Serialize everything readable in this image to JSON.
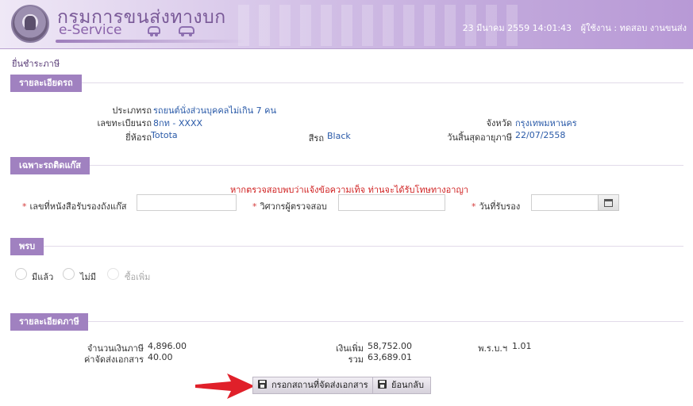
{
  "header": {
    "brand_th": "กรมการขนส่งทางบก",
    "brand_en": "e-Service",
    "datetime": "23 มีนาคม 2559 14:01:43",
    "user_label": "ผู้ใช้งาน : ทดสอบ  งานขนส่ง"
  },
  "breadcrumb": "ยื่นชำระภาษี",
  "vehicle": {
    "title": "รายละเอียดรถ",
    "type_label": "ประเภทรถ",
    "type_value": "รถยนต์นั่งส่วนบุคคลไม่เกิน 7 คน",
    "plate_label": "เลขทะเบียนรถ",
    "plate_value": "8กท - XXXX",
    "province_label": "จังหวัด",
    "province_value": "กรุงเทพมหานคร",
    "brand_label": "ยี่ห้อรถ",
    "brand_value": "Totota",
    "color_label": "สีรถ",
    "color_value": "Black",
    "expiry_label": "วันสิ้นสุดอายุภาษี",
    "expiry_value": "22/07/2558"
  },
  "gas": {
    "title": "เฉพาะรถติดแก๊ส",
    "warning": "หากตรวจสอบพบว่าแจ้งข้อความเท็จ ท่านจะได้รับโทษทางอาญา",
    "cert_label": "เลขที่หนังสือรับรองถังแก๊ส",
    "cert_value": "",
    "engineer_label": "วิศวกรผู้ตรวจสอบ",
    "engineer_value": "",
    "date_label": "วันที่รับรอง",
    "date_value": ""
  },
  "insurance": {
    "title": "พรบ",
    "options": [
      "มีแล้ว",
      "ไม่มี",
      "ซื้อเพิ่ม"
    ]
  },
  "tax": {
    "title": "รายละเอียดภาษี",
    "amount_label": "จำนวนเงินภาษี",
    "amount_value": "4,896.00",
    "surcharge_label": "เงินเพิ่ม",
    "surcharge_value": "58,752.00",
    "act_label": "พ.ร.บ.ฯ",
    "act_value": "1.01",
    "shipping_label": "ค่าจัดส่งเอกสาร",
    "shipping_value": "40.00",
    "total_label": "รวม",
    "total_value": "63,689.01"
  },
  "actions": {
    "address_button": "กรอกสถานที่จัดส่งเอกสาร",
    "back_button": "ย้อนกลับ"
  },
  "colors": {
    "accent": "#a081c0",
    "value_text": "#2a5aa8",
    "warning": "#d02020",
    "arrow": "#e0202a"
  }
}
